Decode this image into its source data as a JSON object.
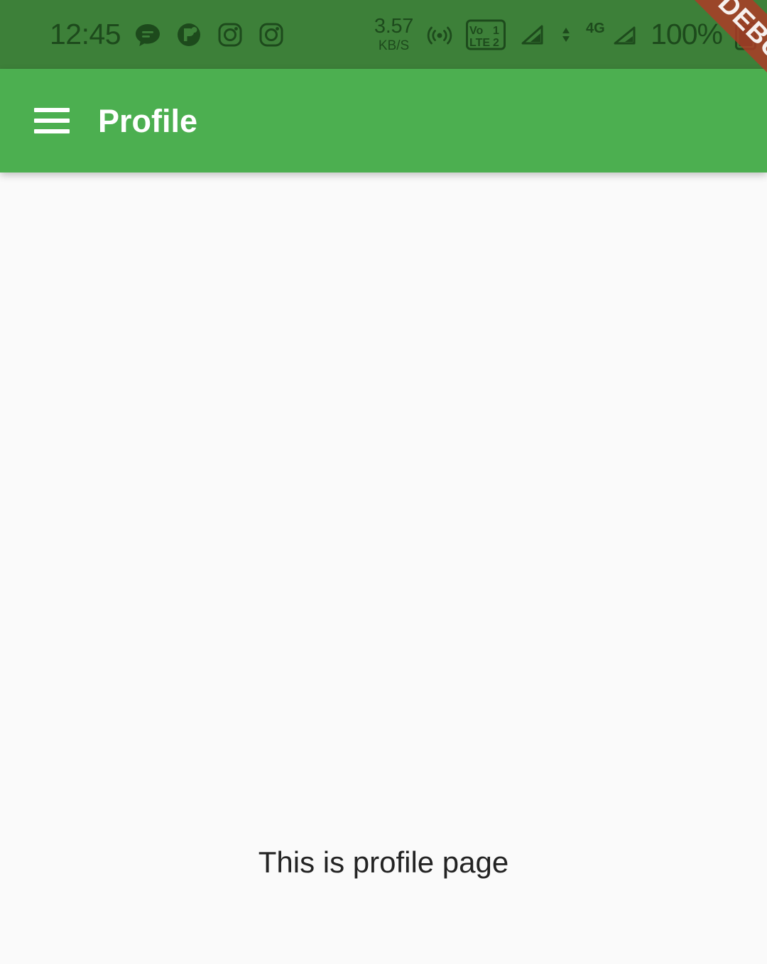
{
  "status_bar": {
    "time": "12:45",
    "background_color": "#3d8039",
    "foreground_color": "#1d4a1c",
    "notification_icons": [
      {
        "name": "message-bubble-icon",
        "label": "Messages"
      },
      {
        "name": "app-circle-icon",
        "label": "App notification"
      },
      {
        "name": "instagram-icon-1",
        "label": "Instagram"
      },
      {
        "name": "instagram-icon-2",
        "label": "Instagram"
      }
    ],
    "network_speed": {
      "value": "3.57",
      "unit": "KB/S"
    },
    "hotspot_icon": "hotspot-icon",
    "volte": {
      "label_top": "Vo",
      "label_bottom": "LTE",
      "sim_1": "1",
      "sim_2": "2"
    },
    "signal_1_icon": "signal-bars-icon",
    "data_transfer_icon": "data-updown-icon",
    "network_type": "4G",
    "signal_2_icon": "signal-bars-icon",
    "battery_percent": "100%",
    "battery_icon": "battery-full-icon"
  },
  "debug_banner": {
    "label": "DEBUG",
    "color": "#b03926"
  },
  "app_bar": {
    "title": "Profile",
    "menu_icon": "hamburger-menu-icon",
    "background_color": "#4caf50",
    "text_color": "#ffffff"
  },
  "main": {
    "body_text": "This is profile page",
    "background_color": "#fafafa"
  }
}
